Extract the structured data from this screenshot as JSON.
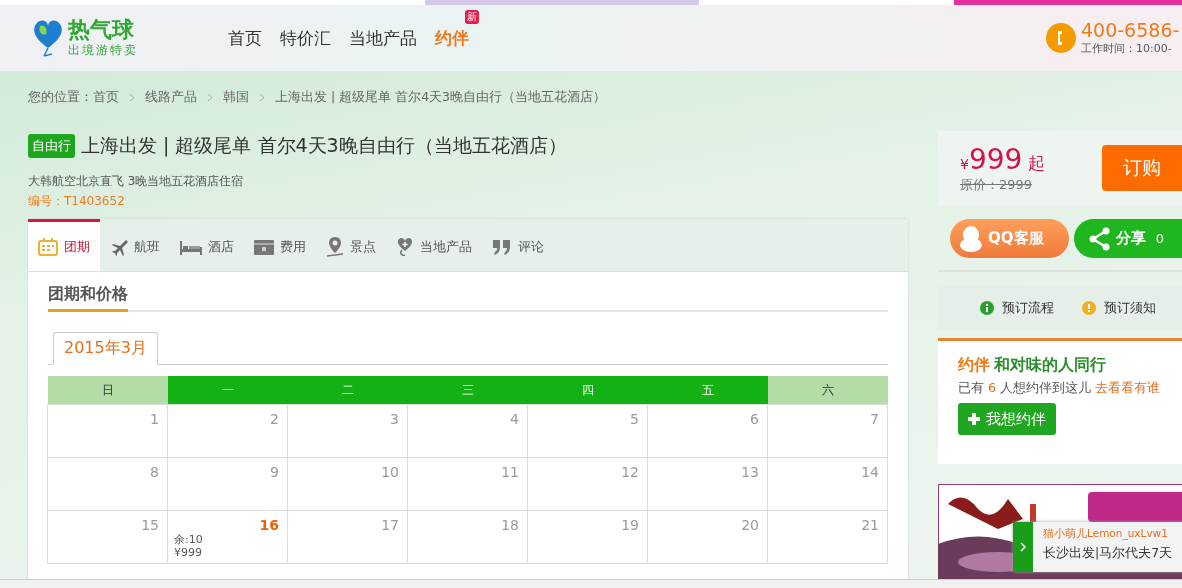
{
  "header": {
    "logo": {
      "name": "热气球",
      "slogan": "出境游特卖"
    },
    "nav": [
      {
        "label": "首页",
        "kind": "plain"
      },
      {
        "label": "特价汇",
        "kind": "plain"
      },
      {
        "label": "当地产品",
        "kind": "plain"
      },
      {
        "label": "约伴",
        "kind": "yueban",
        "badge": "新"
      }
    ],
    "phone": {
      "number": "400-6586-",
      "hours": "工作时间：10:00-"
    }
  },
  "breadcrumb": {
    "prefix": "您的位置：",
    "items": [
      "首页",
      "线路产品",
      "韩国",
      "上海出发 | 超级尾单 首尔4天3晚自由行（当地五花酒店）"
    ]
  },
  "product": {
    "tag": "自由行",
    "title": "上海出发 | 超级尾单 首尔4天3晚自由行（当地五花酒店）",
    "subtitle": "大韩航空北京直飞 3晚当地五花酒店住宿",
    "code": "编号：T1403652"
  },
  "price": {
    "currency": "¥",
    "amount": "999",
    "suffix": "起",
    "original": "原价：2999",
    "button": "订购"
  },
  "tabs": [
    {
      "label": "团期",
      "selected": true
    },
    {
      "label": "航班",
      "selected": false
    },
    {
      "label": "酒店",
      "selected": false
    },
    {
      "label": "费用",
      "selected": false
    },
    {
      "label": "景点",
      "selected": false
    },
    {
      "label": "当地产品",
      "selected": false
    },
    {
      "label": "评论",
      "selected": false
    }
  ],
  "section_title": "团期和价格",
  "calendar": {
    "month_tab": "2015年3月",
    "weekdays": [
      {
        "label": "日",
        "weekend": true
      },
      {
        "label": "一",
        "weekend": false
      },
      {
        "label": "二",
        "weekend": false
      },
      {
        "label": "三",
        "weekend": false
      },
      {
        "label": "四",
        "weekend": false
      },
      {
        "label": "五",
        "weekend": false
      },
      {
        "label": "六",
        "weekend": true
      }
    ],
    "weeks": [
      [
        {
          "day": "1",
          "selected": false
        },
        {
          "day": "2",
          "selected": false
        },
        {
          "day": "3",
          "selected": false
        },
        {
          "day": "4",
          "selected": false
        },
        {
          "day": "5",
          "selected": false
        },
        {
          "day": "6",
          "selected": false
        },
        {
          "day": "7",
          "selected": false
        }
      ],
      [
        {
          "day": "8",
          "selected": false
        },
        {
          "day": "9",
          "selected": false
        },
        {
          "day": "10",
          "selected": false
        },
        {
          "day": "11",
          "selected": false
        },
        {
          "day": "12",
          "selected": false
        },
        {
          "day": "13",
          "selected": false
        },
        {
          "day": "14",
          "selected": false
        }
      ],
      [
        {
          "day": "15",
          "selected": false
        },
        {
          "day": "16",
          "selected": true,
          "remaining": "余:10",
          "price": "¥999"
        },
        {
          "day": "17",
          "selected": false
        },
        {
          "day": "18",
          "selected": false
        },
        {
          "day": "19",
          "selected": false
        },
        {
          "day": "20",
          "selected": false
        },
        {
          "day": "21",
          "selected": false
        }
      ]
    ]
  },
  "side": {
    "qq_button": "QQ客服",
    "share": {
      "label": "分享",
      "count": "0"
    },
    "links": [
      {
        "label": "预订流程",
        "kind": "info"
      },
      {
        "label": "预订须知",
        "kind": "warning"
      }
    ],
    "yueban": {
      "logo": "约伴",
      "title": "和对味的人同行",
      "text_before": "已有",
      "count": "6",
      "text_after": "人想约伴到这儿",
      "link": "去看看有谁",
      "button": "我想约伴"
    },
    "toast": {
      "user": "猫小萌儿Lemon_uxLvw1",
      "trip": "长沙出发|马尔代夫7天"
    }
  }
}
